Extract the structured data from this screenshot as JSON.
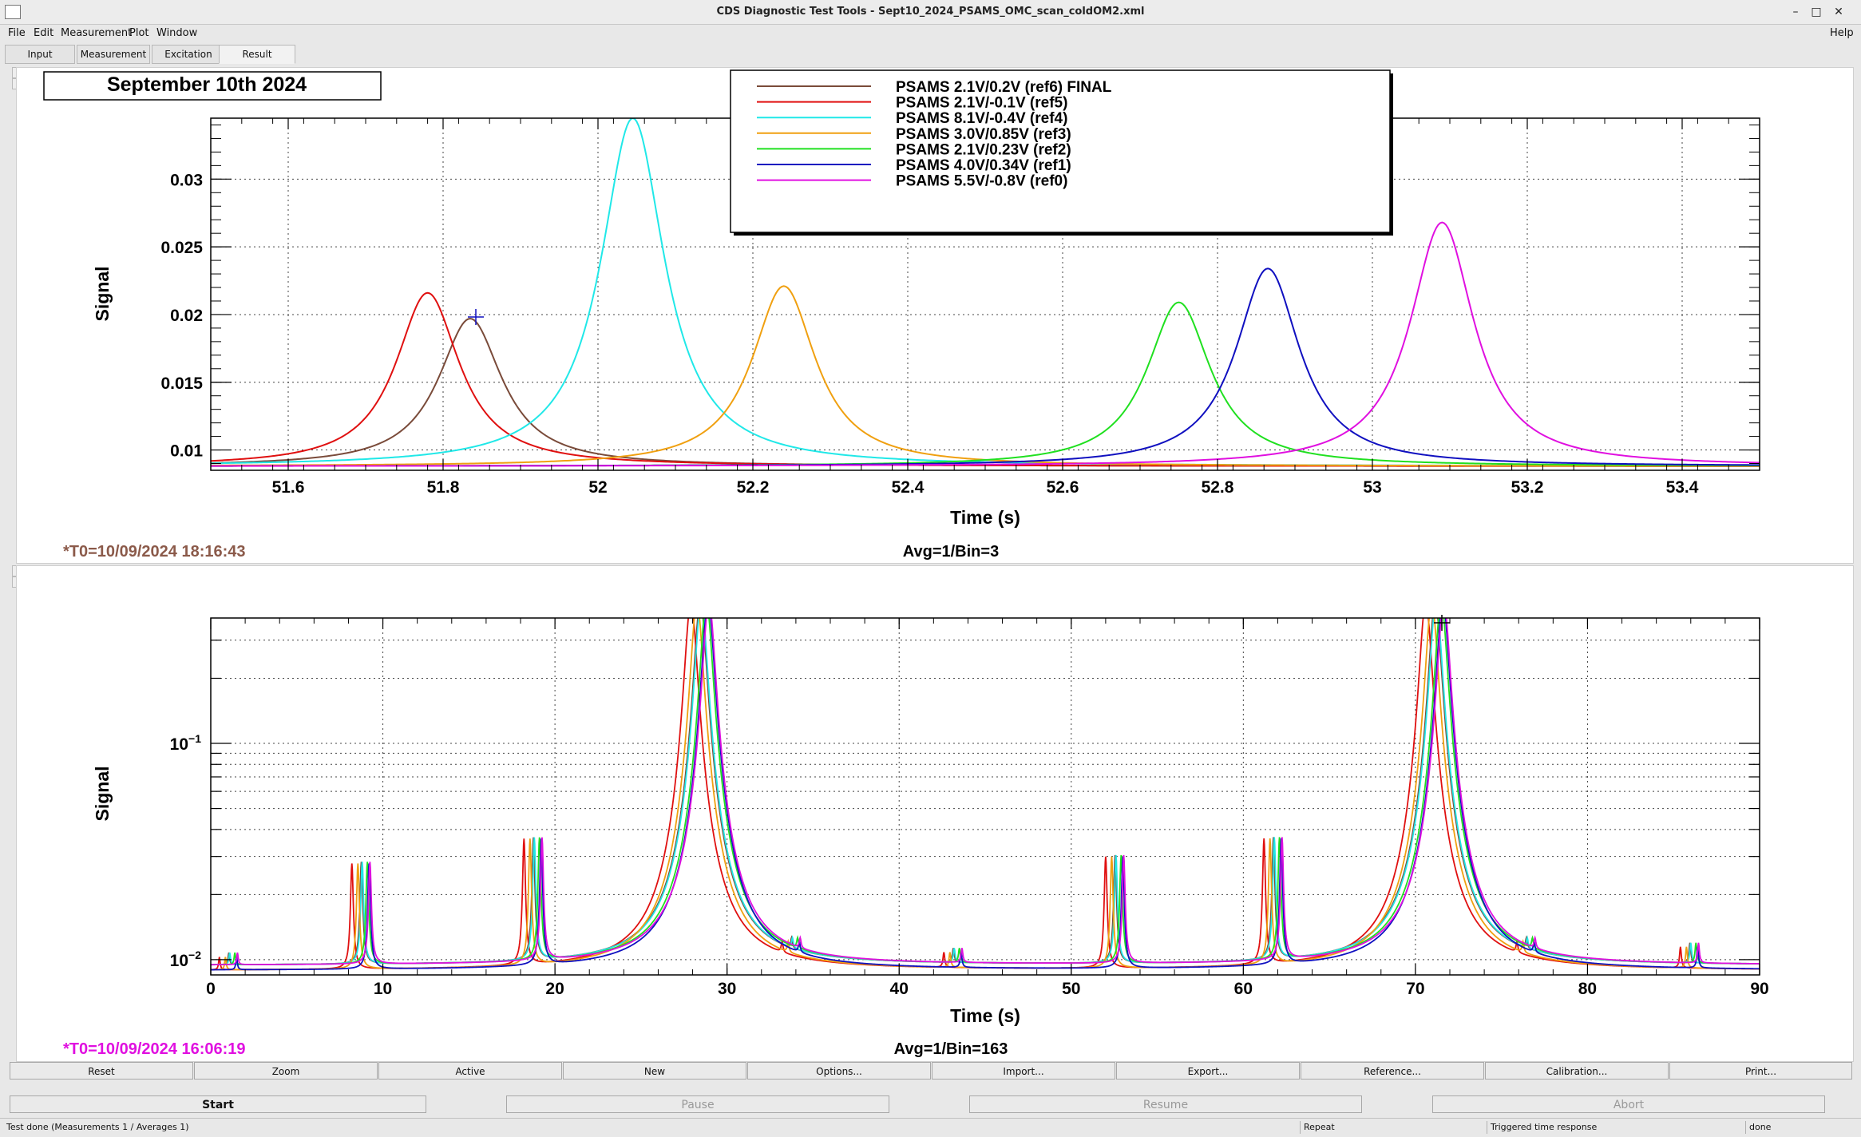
{
  "window": {
    "title": "CDS Diagnostic Test Tools - Sept10_2024_PSAMS_OMC_scan_coldOM2.xml"
  },
  "menu": {
    "items": [
      "File",
      "Edit",
      "Measurement",
      "Plot",
      "Window"
    ],
    "help": "Help"
  },
  "tabs": [
    "Input",
    "Measurement",
    "Excitation",
    "Result"
  ],
  "annotation": {
    "date_label": "September 10th 2024"
  },
  "colors": {
    "ref6": "#7a4b3a",
    "ref5": "#e01010",
    "ref4": "#20e8e8",
    "ref3": "#f0a010",
    "ref2": "#20e020",
    "ref1": "#1010c0",
    "ref0": "#e010e0",
    "t0_top": "#8b5a4a",
    "t0_bottom": "#e010e0"
  },
  "panels": {
    "top": {
      "t0_label": "*T0=10/09/2024 18:16:43",
      "avg_label": "Avg=1/Bin=3"
    },
    "bottom": {
      "t0_label": "*T0=10/09/2024 16:06:19",
      "avg_label": "Avg=1/Bin=163"
    }
  },
  "chart_data": [
    {
      "type": "line",
      "xlabel": "Time (s)",
      "ylabel": "Signal",
      "xlim": [
        51.5,
        53.5
      ],
      "ylim": [
        0.0085,
        0.0345
      ],
      "x_ticks": [
        "51.6",
        "51.8",
        "52",
        "52.2",
        "52.4",
        "52.6",
        "52.8",
        "53",
        "53.2",
        "53.4"
      ],
      "y_ticks": [
        "0.01",
        "0.015",
        "0.02",
        "0.025",
        "0.03"
      ],
      "grid": true,
      "legend_position": "top-center",
      "series": [
        {
          "name": "PSAMS 2.1V/0.2V (ref6) FINAL",
          "color": "#7a4b3a",
          "peak_x": 51.835,
          "peak_y": 0.0197,
          "baseline": 0.0088,
          "width": 0.05
        },
        {
          "name": "PSAMS 2.1V/-0.1V (ref5)",
          "color": "#e01010",
          "peak_x": 51.78,
          "peak_y": 0.0216,
          "baseline": 0.0088,
          "width": 0.05
        },
        {
          "name": "PSAMS 8.1V/-0.4V (ref4)",
          "color": "#20e8e8",
          "peak_x": 52.045,
          "peak_y": 0.0345,
          "baseline": 0.0088,
          "width": 0.05
        },
        {
          "name": "PSAMS 3.0V/0.85V (ref3)",
          "color": "#f0a010",
          "peak_x": 52.24,
          "peak_y": 0.0221,
          "baseline": 0.0088,
          "width": 0.05
        },
        {
          "name": "PSAMS 2.1V/0.23V (ref2)",
          "color": "#20e020",
          "peak_x": 52.75,
          "peak_y": 0.0209,
          "baseline": 0.0088,
          "width": 0.05
        },
        {
          "name": "PSAMS 4.0V/0.34V (ref1)",
          "color": "#1010c0",
          "peak_x": 52.865,
          "peak_y": 0.0234,
          "baseline": 0.0088,
          "width": 0.05
        },
        {
          "name": " PSAMS 5.5V/-0.8V (ref0)",
          "color": "#e010e0",
          "peak_x": 53.09,
          "peak_y": 0.0268,
          "baseline": 0.0088,
          "width": 0.05
        }
      ]
    },
    {
      "type": "line",
      "xlabel": "Time (s)",
      "ylabel": "Signal",
      "xlim": [
        0,
        90
      ],
      "ylim": [
        0.0085,
        0.38
      ],
      "yscale": "log",
      "x_ticks": [
        "0",
        "10",
        "20",
        "30",
        "40",
        "50",
        "60",
        "70",
        "80",
        "90"
      ],
      "y_ticks": [
        "10^-2",
        "10^-1"
      ],
      "grid": true,
      "series_colors": [
        "#7a4b3a",
        "#e01010",
        "#20e8e8",
        "#f0a010",
        "#20e020",
        "#1010c0",
        "#e010e0"
      ],
      "peak_offsets": [
        0.55,
        0,
        0.6,
        0.35,
        0.9,
        1.0,
        1.05
      ],
      "baseline": 0.0092,
      "peaks": [
        {
          "x": 0.5,
          "height": 0.0105,
          "width": 0.05
        },
        {
          "x": 8.2,
          "height": 0.028,
          "width": 0.08
        },
        {
          "x": 18.2,
          "height": 0.036,
          "width": 0.08
        },
        {
          "x": 27.9,
          "height": 0.45,
          "width": 0.35
        },
        {
          "x": 33.2,
          "height": 0.0105,
          "width": 0.06
        },
        {
          "x": 42.6,
          "height": 0.0108,
          "width": 0.06
        },
        {
          "x": 52.0,
          "height": 0.03,
          "width": 0.08
        },
        {
          "x": 61.2,
          "height": 0.036,
          "width": 0.08
        },
        {
          "x": 70.6,
          "height": 0.45,
          "width": 0.35
        },
        {
          "x": 75.9,
          "height": 0.0105,
          "width": 0.06
        },
        {
          "x": 85.4,
          "height": 0.0115,
          "width": 0.06
        }
      ]
    }
  ],
  "controls": {
    "buttons": [
      "Reset",
      "Zoom",
      "Active",
      "New",
      "Options...",
      "Import...",
      "Export...",
      "Reference...",
      "Calibration...",
      "Print..."
    ]
  },
  "run_controls": {
    "start": "Start",
    "pause": "Pause",
    "resume": "Resume",
    "abort": "Abort"
  },
  "status": {
    "message": "Test done (Measurements 1 / Averages 1)",
    "mode": "Repeat",
    "type": "Triggered time response",
    "state": "done"
  }
}
